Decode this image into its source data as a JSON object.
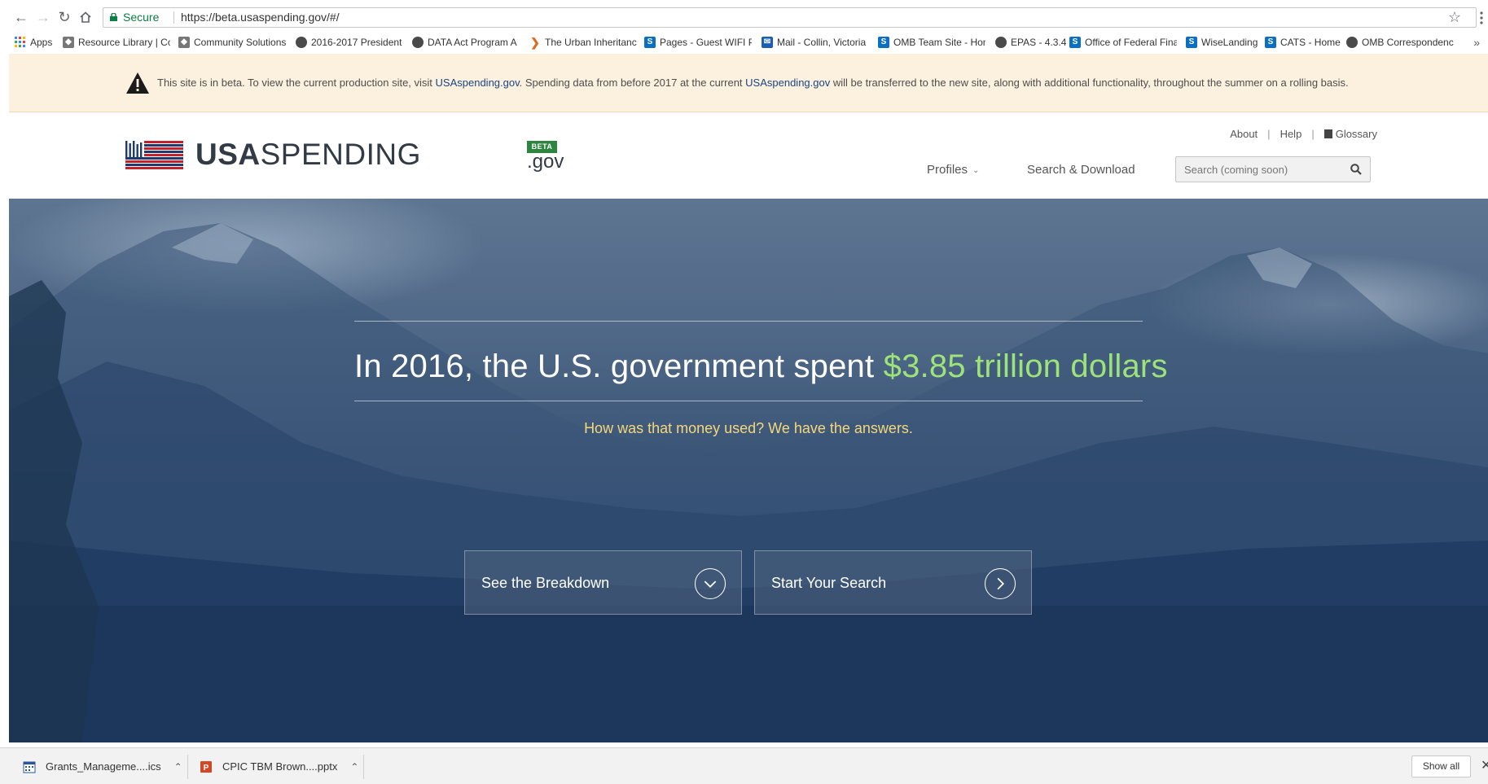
{
  "browser": {
    "secure_label": "Secure",
    "url": "https://beta.usaspending.gov/#/",
    "bookmarks": [
      {
        "label": "Apps",
        "icon": "apps-grid-icon",
        "color": "#4285f4"
      },
      {
        "label": "Resource Library | Co",
        "icon": "community-icon",
        "color": "#6b6b6b"
      },
      {
        "label": "Community Solutions",
        "icon": "community-icon",
        "color": "#6b6b6b"
      },
      {
        "label": "2016-2017 President",
        "icon": "globe-icon",
        "color": "#4a4a4a"
      },
      {
        "label": "DATA Act Program A",
        "icon": "globe-icon",
        "color": "#4a4a4a"
      },
      {
        "label": "The Urban Inheritanc",
        "icon": "chevron-icon",
        "color": "#e06a1b"
      },
      {
        "label": "Pages - Guest WIFI P",
        "icon": "sharepoint-icon",
        "color": "#0b6fc3"
      },
      {
        "label": "Mail - Collin, Victoria",
        "icon": "mail-icon",
        "color": "#1a5fb4"
      },
      {
        "label": "OMB Team Site - Hon",
        "icon": "sharepoint-icon",
        "color": "#0b6fc3"
      },
      {
        "label": "EPAS - 4.3.4",
        "icon": "globe-icon",
        "color": "#4a4a4a"
      },
      {
        "label": "Office of Federal Fina",
        "icon": "sharepoint-icon",
        "color": "#0b6fc3"
      },
      {
        "label": "WiseLanding",
        "icon": "sharepoint-icon",
        "color": "#0b6fc3"
      },
      {
        "label": "CATS - Home",
        "icon": "sharepoint-icon",
        "color": "#0b6fc3"
      },
      {
        "label": "OMB Correspondenc",
        "icon": "globe-icon",
        "color": "#4a4a4a"
      }
    ],
    "more_label": "»"
  },
  "banner": {
    "pre": "This site is in beta. To view the current production site, visit ",
    "link1": "USAspending.gov",
    "mid": ". Spending data from before 2017 at the current ",
    "link2": "USAspending.gov",
    "post": " will be transferred to the new site, along with additional functionality, throughout the summer on a rolling basis."
  },
  "header": {
    "logo_bold": "USA",
    "logo_light": "SPENDING",
    "beta_tag": "BETA",
    "gov": ".gov",
    "util_links": {
      "about": "About",
      "help": "Help",
      "glossary": "Glossary"
    },
    "nav": {
      "profiles": "Profiles",
      "search_download": "Search & Download"
    },
    "search_placeholder": "Search (coming soon)"
  },
  "hero": {
    "title_pre": "In 2016, the U.S. government spent ",
    "title_amount": "$3.85 trillion dollars",
    "subtitle": "How was that money used? We have the answers.",
    "cta_breakdown": "See the Breakdown",
    "cta_search": "Start Your Search",
    "amount_color": "#9de37a",
    "subtitle_color": "#f5d77b"
  },
  "downloads": {
    "items": [
      {
        "name": "Grants_Manageme....ics",
        "icon": "calendar-file-icon"
      },
      {
        "name": "CPIC TBM Brown....pptx",
        "icon": "powerpoint-file-icon"
      }
    ],
    "show_all": "Show all"
  }
}
